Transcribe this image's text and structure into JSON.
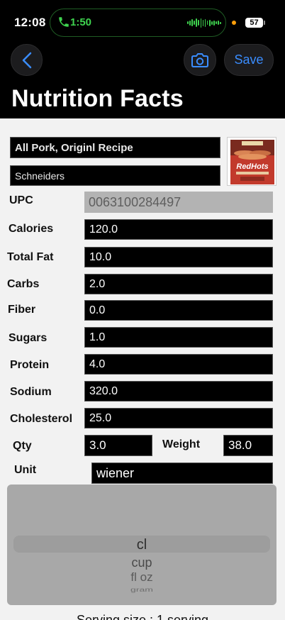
{
  "status": {
    "time": "12:08",
    "call_duration": "1:50",
    "battery": "57"
  },
  "nav": {
    "save_label": "Save"
  },
  "page": {
    "title": "Nutrition Facts"
  },
  "product": {
    "name": "All Pork, Originl Recipe",
    "brand": "Schneiders",
    "image_brand_text": "RedHots"
  },
  "fields": {
    "upc_label": "UPC",
    "upc_value": "0063100284497",
    "calories_label": "Calories",
    "calories_value": "120.0",
    "total_fat_label": "Total Fat",
    "total_fat_value": "10.0",
    "carbs_label": "Carbs",
    "carbs_value": "2.0",
    "fiber_label": "Fiber",
    "fiber_value": "0.0",
    "sugars_label": "Sugars",
    "sugars_value": "1.0",
    "protein_label": "Protein",
    "protein_value": "4.0",
    "sodium_label": "Sodium",
    "sodium_value": "320.0",
    "cholesterol_label": "Cholesterol",
    "cholesterol_value": "25.0",
    "qty_label": "Qty",
    "qty_value": "3.0",
    "weight_label": "Weight",
    "weight_value": "38.0",
    "unit_label": "Unit",
    "unit_value": "wiener"
  },
  "unit_picker": {
    "selected": "cl",
    "options": [
      "cup",
      "fl oz",
      "gram"
    ]
  },
  "serving_text": "Serving size : 1 serving",
  "colors": {
    "accent": "#3a8dff",
    "call_green": "#3fd34f",
    "field_background": "#000000",
    "page_background": "#f2f2f2"
  }
}
